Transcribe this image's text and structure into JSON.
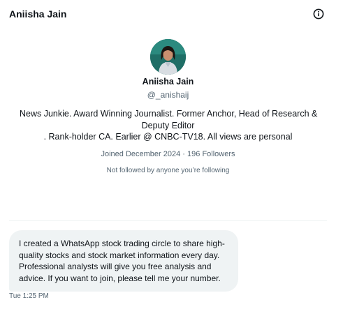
{
  "header": {
    "title": "Aniisha Jain",
    "info_icon": "info-circle-icon"
  },
  "profile": {
    "avatar_icon": "profile-photo",
    "name": "Aniisha Jain",
    "handle": "@_anishaij",
    "bio_lines": [
      "News Junkie. Award Winning Journalist. Former Anchor, Head of Research &",
      "Deputy Editor",
      ". Rank-holder CA. Earlier @ CNBC-TV18. All views are personal"
    ],
    "joined": "Joined December 2024",
    "separator": "·",
    "followers": "196 Followers",
    "follow_note": "Not followed by anyone you’re following"
  },
  "conversation": {
    "messages": [
      {
        "lines": [
          "I created a WhatsApp stock trading circle to share high-",
          "quality stocks and stock market information every day.",
          "Professional analysts will give you free analysis and",
          "advice. If you want to join, please tell me your number."
        ],
        "time": "Tue 1:25 PM"
      }
    ]
  },
  "colors": {
    "text_primary": "#0f1419",
    "text_secondary": "#536471",
    "bubble_bg": "#eff3f4",
    "divider": "#eff3f4"
  }
}
